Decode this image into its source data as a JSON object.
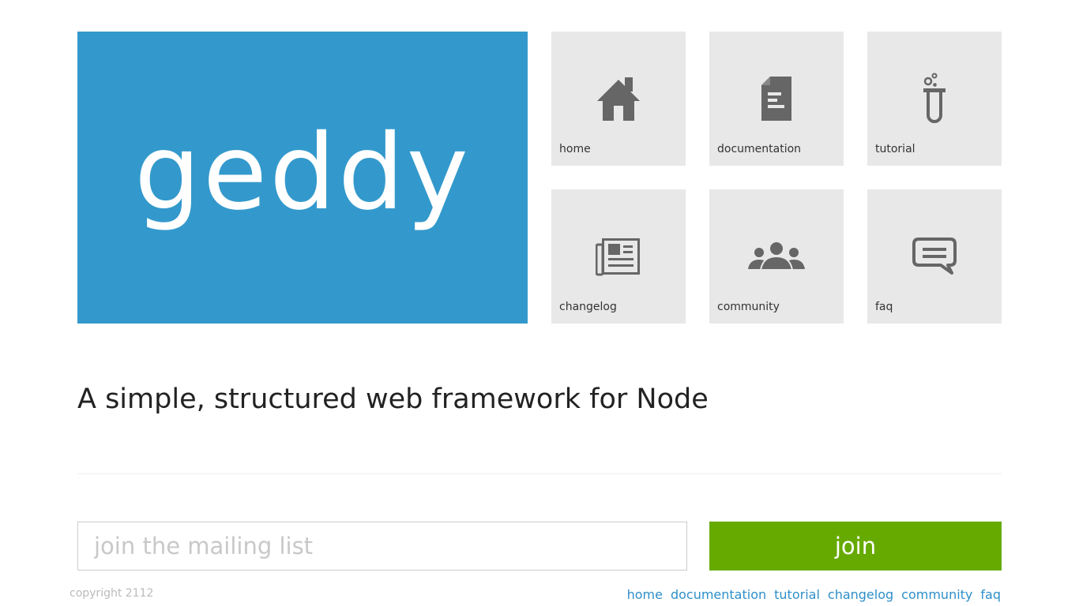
{
  "logo": {
    "text": "geddy",
    "background": "#3399cc"
  },
  "tiles": [
    {
      "label": "home",
      "icon": "home-icon"
    },
    {
      "label": "documentation",
      "icon": "document-icon"
    },
    {
      "label": "tutorial",
      "icon": "test-tube-icon"
    },
    {
      "label": "changelog",
      "icon": "newspaper-icon"
    },
    {
      "label": "community",
      "icon": "people-icon"
    },
    {
      "label": "faq",
      "icon": "chat-bubble-icon"
    }
  ],
  "tagline": "A simple, structured web framework for Node",
  "mailing": {
    "placeholder": "join the mailing list",
    "value": "",
    "button_label": "join",
    "button_color": "#66aa00"
  },
  "footer": {
    "copyright": "copyright 2112",
    "links": [
      "home",
      "documentation",
      "tutorial",
      "changelog",
      "community",
      "faq"
    ]
  }
}
